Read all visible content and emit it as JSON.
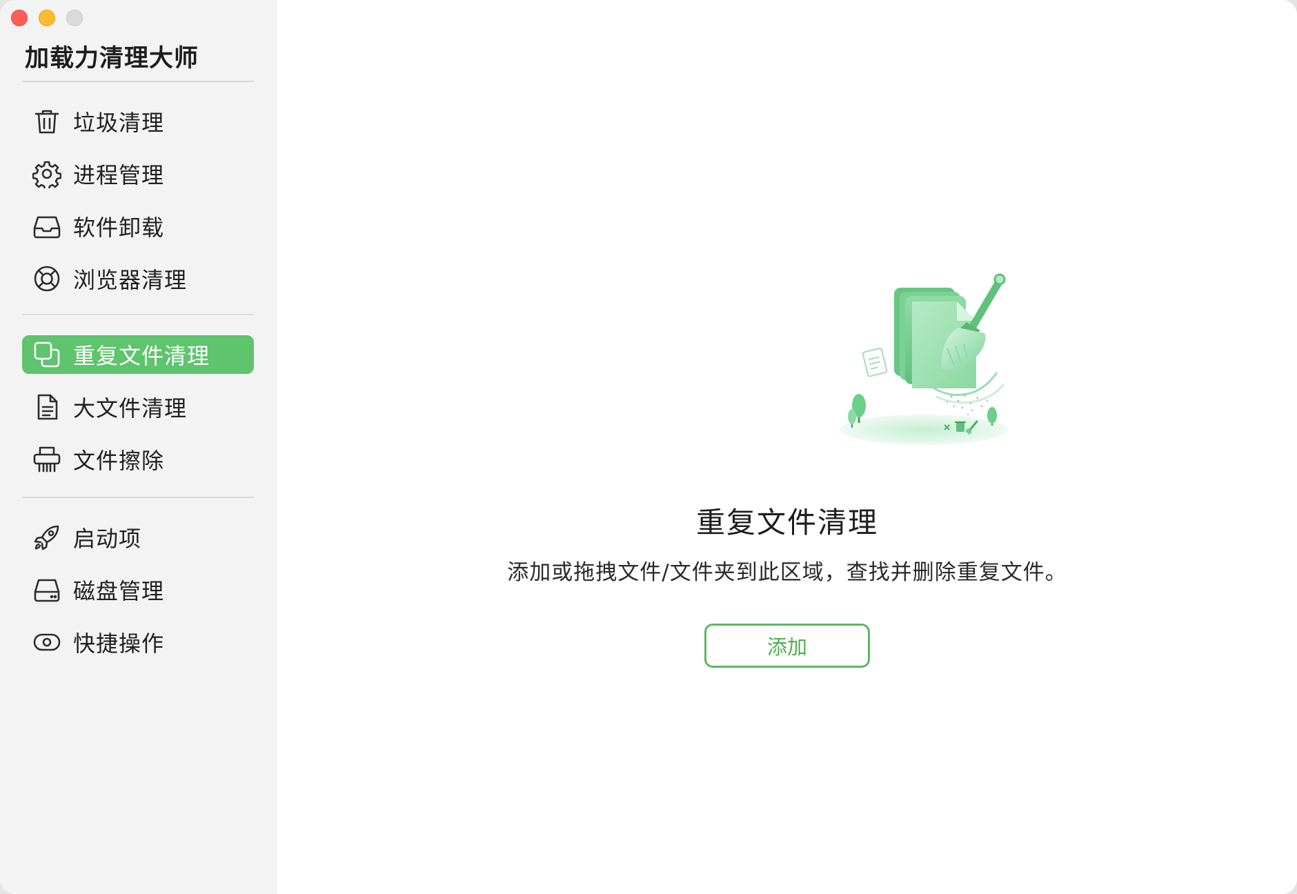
{
  "app": {
    "title": "加载力清理大师"
  },
  "sidebar": {
    "groups": [
      [
        {
          "label": "垃圾清理",
          "icon": "trash-icon"
        },
        {
          "label": "进程管理",
          "icon": "gear-icon"
        },
        {
          "label": "软件卸载",
          "icon": "tray-icon"
        },
        {
          "label": "浏览器清理",
          "icon": "lifebuoy-icon"
        }
      ],
      [
        {
          "label": "重复文件清理",
          "icon": "duplicate-icon",
          "active": true
        },
        {
          "label": "大文件清理",
          "icon": "document-icon"
        },
        {
          "label": "文件擦除",
          "icon": "shredder-icon"
        }
      ],
      [
        {
          "label": "启动项",
          "icon": "rocket-icon"
        },
        {
          "label": "磁盘管理",
          "icon": "disk-icon"
        },
        {
          "label": "快捷操作",
          "icon": "toggle-icon"
        }
      ]
    ]
  },
  "main": {
    "title": "重复文件清理",
    "description": "添加或拖拽文件/文件夹到此区域，查找并删除重复文件。",
    "add_button": "添加"
  },
  "colors": {
    "accent": "#5ec46d",
    "sidebar_bg": "#f3f3f3",
    "button_border": "#5cb862"
  }
}
